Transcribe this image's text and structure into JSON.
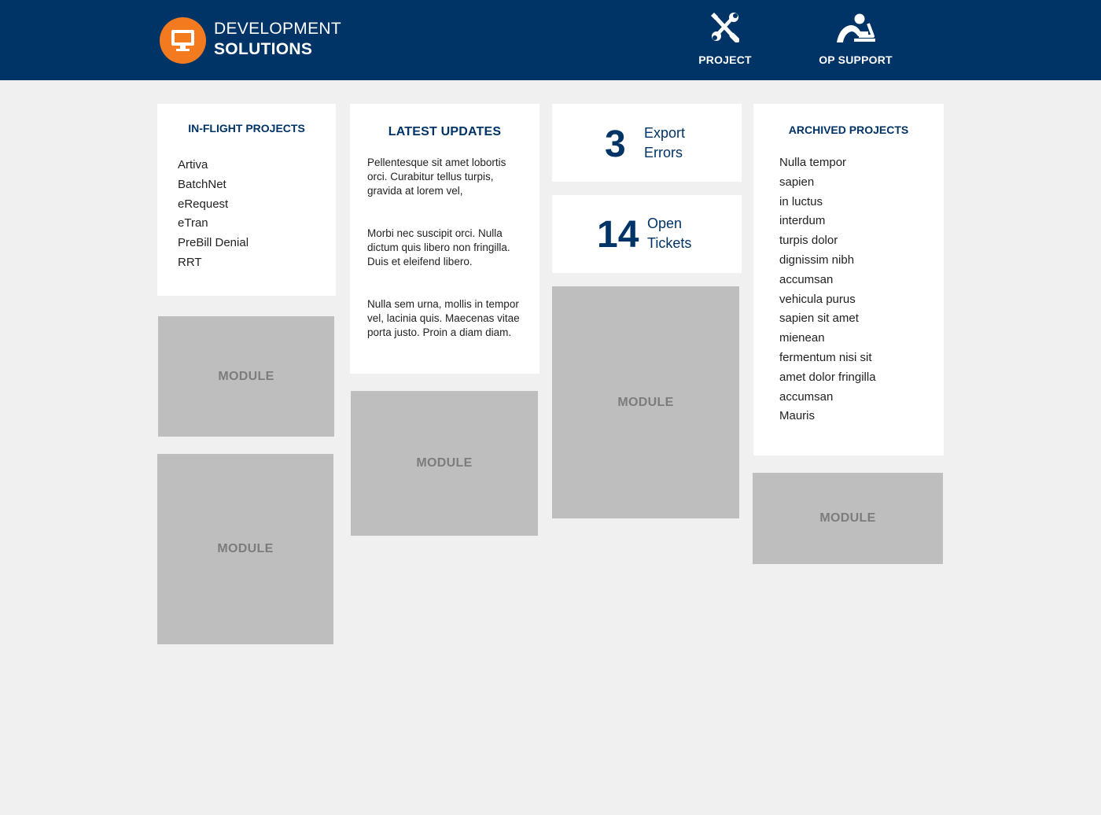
{
  "header": {
    "logo_icon": "monitor-icon",
    "brand_line1": "DEVELOPMENT",
    "brand_line2": "SOLUTIONS",
    "nav": [
      {
        "label": "PROJECT",
        "icon": "tools-icon"
      },
      {
        "label": "OP SUPPORT",
        "icon": "support-person-icon"
      }
    ],
    "colors": {
      "background": "#003366",
      "logo_circle": "#f47a20"
    }
  },
  "inflight": {
    "title": "IN-FLIGHT PROJECTS",
    "items": [
      "Artiva",
      "BatchNet",
      "eRequest",
      "eTran",
      "PreBill Denial",
      "RRT"
    ]
  },
  "updates": {
    "title": "LATEST UPDATES",
    "paragraphs": [
      "Pellentesque sit amet lobortis orci. Curabitur tellus turpis, gravida at lorem vel,",
      "Morbi nec suscipit orci. Nulla dictum quis libero non fringilla. Duis et eleifend libero.",
      "Nulla sem urna, mollis in tempor vel, lacinia quis. Maecenas vitae porta justo. Proin a diam diam."
    ]
  },
  "stats": {
    "errors": {
      "value": "3",
      "label": "Export Errors"
    },
    "tickets": {
      "value": "14",
      "label": "Open Tickets"
    }
  },
  "archived": {
    "title": "ARCHIVED PROJECTS",
    "items": [
      "Nulla tempor",
      "sapien",
      "in luctus",
      "interdum",
      "turpis dolor",
      "dignissim nibh",
      "accumsan",
      "vehicula purus",
      "sapien sit amet",
      "mienean",
      "fermentum nisi sit",
      "amet dolor fringilla",
      "accumsan",
      "Mauris"
    ]
  },
  "modules": {
    "label": "MODULE"
  },
  "colors": {
    "page_bg": "#f0f0f0",
    "accent": "#003366",
    "module_bg": "#bebebe",
    "module_text": "#7c7c7c"
  }
}
